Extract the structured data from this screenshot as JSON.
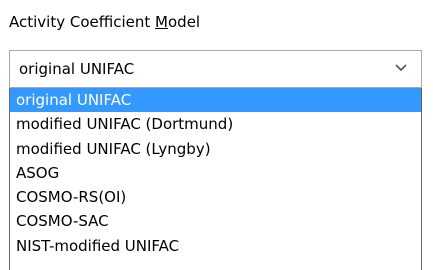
{
  "field": {
    "label_before": "Activity Coefficient ",
    "label_mnemonic": "M",
    "label_after": "odel"
  },
  "combo": {
    "selected_value": "original UNIFAC",
    "arrow_icon": "chevron-down-icon"
  },
  "dropdown": {
    "items": [
      "original UNIFAC",
      "modified UNIFAC (Dortmund)",
      "modified UNIFAC (Lyngby)",
      "ASOG",
      "COSMO-RS(OI)",
      "COSMO-SAC",
      "NIST-modified UNIFAC"
    ],
    "highlighted": "original UNIFAC"
  },
  "colors": {
    "highlight": "#3399ff",
    "border": "#a9a9a9"
  }
}
